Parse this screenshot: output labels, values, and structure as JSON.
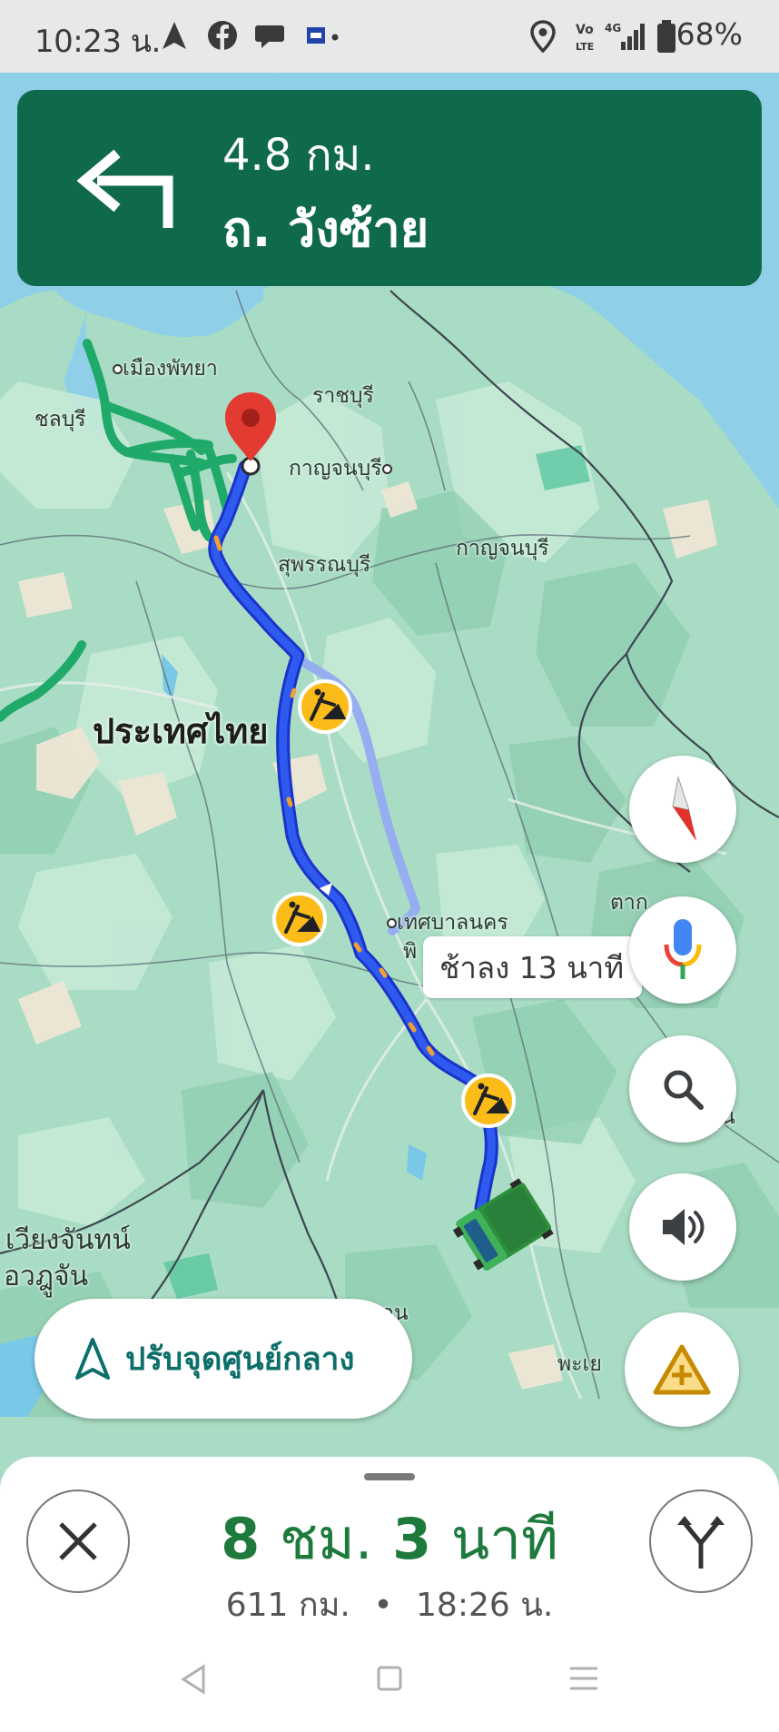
{
  "status_bar": {
    "time": "10:23 น.",
    "battery": "68%",
    "icons": [
      "navigation-arrow-icon",
      "facebook-icon",
      "chat-bubble-icon",
      "app-icon",
      "location-pin-icon",
      "volte-icon",
      "signal-icon",
      "battery-icon"
    ]
  },
  "navigation": {
    "direction_icon": "turn-left-icon",
    "distance": "4.8 กม.",
    "street": "ถ. วังซ้าย"
  },
  "map": {
    "labels": {
      "pattaya": "เมืองพัทยา",
      "chonburi": "ชลบุรี",
      "ratchaburi": "ราชบุรี",
      "kanchanaburi_city": "กาญจนบุรี",
      "suphanburi": "สุพรรณบุรี",
      "kanchanaburi_province": "กาญจนบุรี",
      "country": "ประเทศไทย",
      "municipality": "เทศบาลนคร",
      "tak": "ตาก",
      "vientiane": "เวียงจันทน์",
      "vientiane_partial": "อวฎูจัน",
      "partial_khon": "อน",
      "phayao_partial": "พะเย",
      "right_partial": "ูน",
      "phi_partial": "พิ"
    },
    "eta_bubble": "ช้าลง 13 นาที",
    "route_color": "#1a3ee0",
    "alt_route_color": "#96aef0",
    "traffic_color": "#1faa6a"
  },
  "controls": {
    "compass_icon": "compass-icon",
    "mic_icon": "microphone-icon",
    "search_icon": "search-icon",
    "sound_icon": "volume-icon",
    "report_icon": "add-report-icon",
    "recenter_label": "ปรับจุดศูนย์กลาง"
  },
  "trip": {
    "hours": "8",
    "hours_unit": "ชม.",
    "minutes": "3",
    "minutes_unit": "นาที",
    "distance": "611 กม.",
    "separator": "•",
    "arrival": "18:26 น."
  }
}
